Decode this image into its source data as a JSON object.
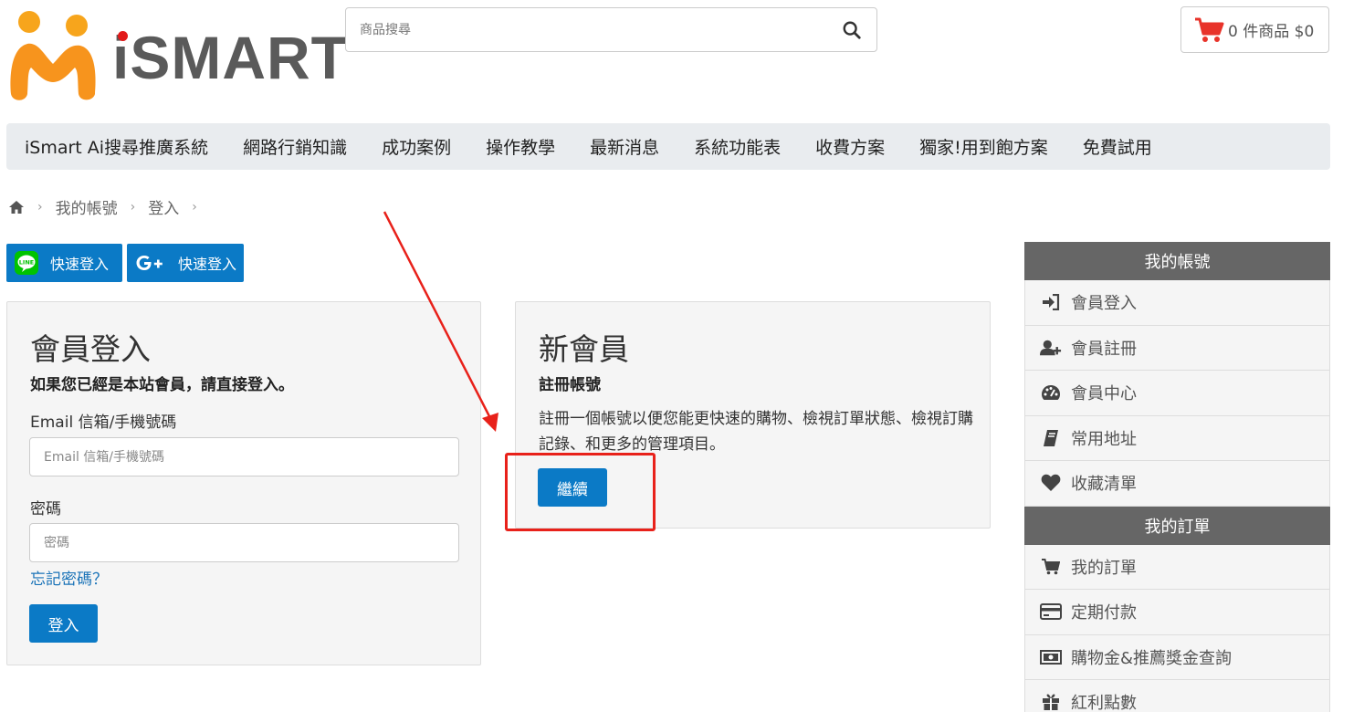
{
  "logo": {
    "text": "iSMART"
  },
  "search": {
    "placeholder": "商品搜尋"
  },
  "cart": {
    "label": "0 件商品 $0"
  },
  "nav": {
    "items": [
      "iSmart Ai搜尋推廣系統",
      "網路行銷知識",
      "成功案例",
      "操作教學",
      "最新消息",
      "系統功能表",
      "收費方案",
      "獨家!用到飽方案",
      "免費試用"
    ]
  },
  "breadcrumb": {
    "items": [
      "我的帳號",
      "登入"
    ]
  },
  "social": {
    "line_label": "快速登入",
    "google_label": "快速登入"
  },
  "login_panel": {
    "title": "會員登入",
    "subtitle": "如果您已經是本站會員，請直接登入。",
    "email_label": "Email 信箱/手機號碼",
    "email_placeholder": "Email 信箱/手機號碼",
    "password_label": "密碼",
    "password_placeholder": "密碼",
    "forgot_label": "忘記密碼？",
    "login_button": "登入"
  },
  "new_panel": {
    "title": "新會員",
    "subtitle": "註冊帳號",
    "description": "註冊一個帳號以便您能更快速的購物、檢視訂單狀態、檢視訂購記錄、和更多的管理項目。",
    "continue_button": "繼續"
  },
  "sidebar": {
    "account_header": "我的帳號",
    "account_items": [
      {
        "label": "會員登入",
        "icon": "sign-in-icon"
      },
      {
        "label": "會員註冊",
        "icon": "user-plus-icon"
      },
      {
        "label": "會員中心",
        "icon": "dashboard-icon"
      },
      {
        "label": "常用地址",
        "icon": "address-book-icon"
      },
      {
        "label": "收藏清單",
        "icon": "heart-icon"
      }
    ],
    "orders_header": "我的訂單",
    "order_items": [
      {
        "label": "我的訂單",
        "icon": "cart-icon"
      },
      {
        "label": "定期付款",
        "icon": "credit-card-icon"
      },
      {
        "label": "購物金&推薦獎金查詢",
        "icon": "money-icon"
      },
      {
        "label": "紅利點數",
        "icon": "gift-icon"
      }
    ]
  },
  "colors": {
    "primary": "#0b7ac6",
    "annotation": "#e8211a",
    "sidebar_header": "#666666",
    "logo_orange": "#f7941d"
  }
}
